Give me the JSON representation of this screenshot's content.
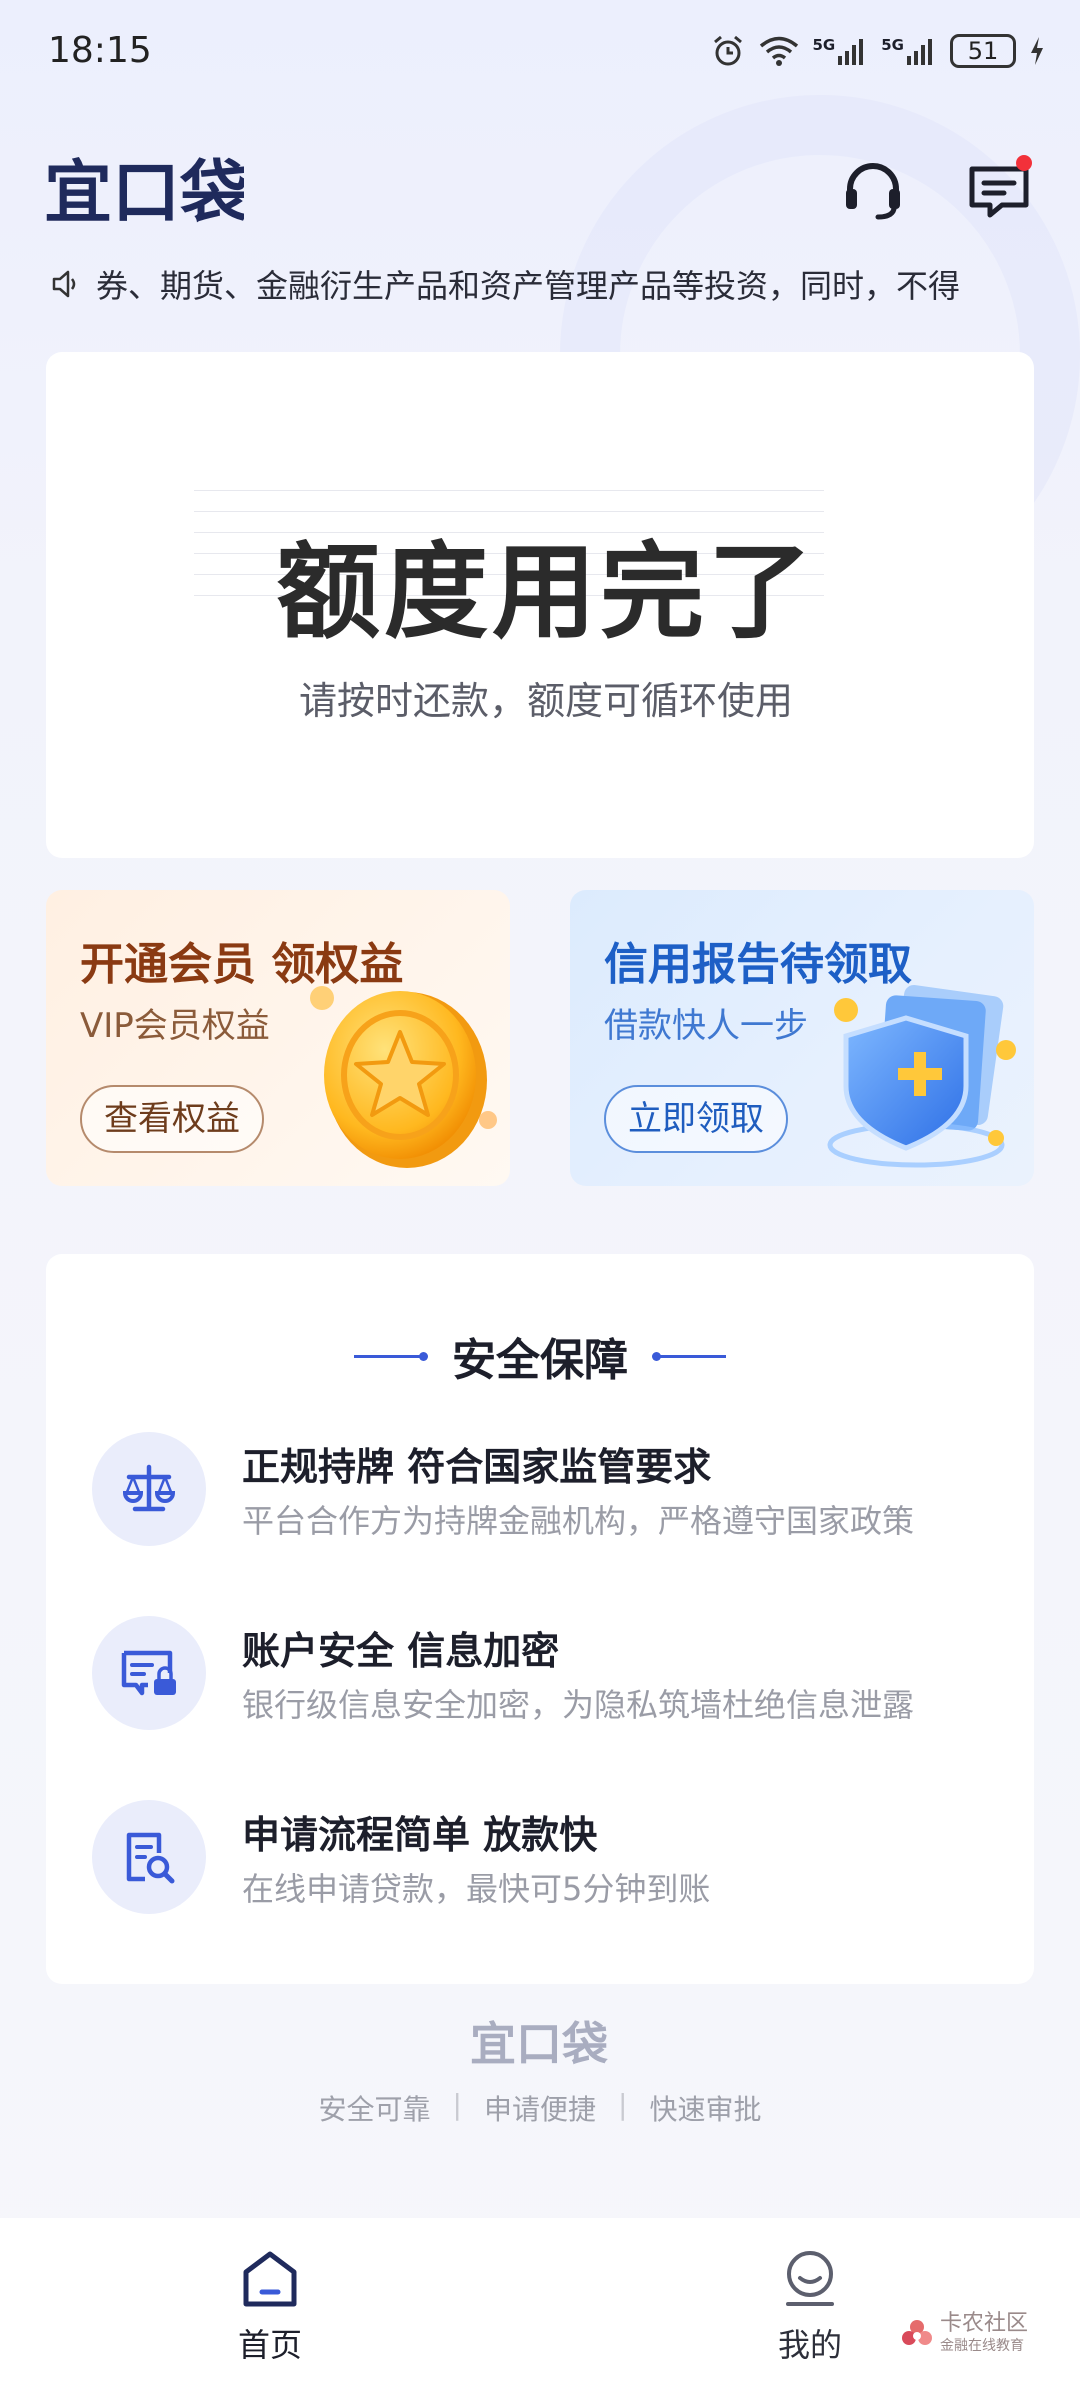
{
  "status_bar": {
    "time": "18:15",
    "battery": "51",
    "signal_1_label": "5G",
    "signal_2_label": "5G"
  },
  "header": {
    "brand_name": "宜口袋",
    "customer_service_icon": "headset-icon",
    "message_icon": "message-icon",
    "has_unread_messages": true
  },
  "notice": {
    "icon": "speaker-icon",
    "text": "券、期货、金融衍生产品和资产管理产品等投资，同时，不得"
  },
  "quota_card": {
    "title": "额度用完了",
    "subtitle": "请按时还款，额度可循环使用"
  },
  "promos": [
    {
      "title": "开通会员 领权益",
      "subtitle": "VIP会员权益",
      "button": "查看权益",
      "art": "gold-star-coin"
    },
    {
      "title": "信用报告待领取",
      "subtitle": "借款快人一步",
      "button": "立即领取",
      "art": "blue-shield"
    }
  ],
  "security": {
    "title": "安全保障",
    "items": [
      {
        "icon": "scale-icon",
        "title": "正规持牌 符合国家监管要求",
        "desc": "平台合作方为持牌金融机构，严格遵守国家政策"
      },
      {
        "icon": "secure-card-icon",
        "title": "账户安全 信息加密",
        "desc": "银行级信息安全加密，为隐私筑墙杜绝信息泄露"
      },
      {
        "icon": "document-search-icon",
        "title": "申请流程简单 放款快",
        "desc": "在线申请贷款，最快可5分钟到账"
      }
    ]
  },
  "footer": {
    "brand_name": "宜口袋",
    "tags": [
      "安全可靠",
      "申请便捷",
      "快速审批"
    ],
    "separator": "|"
  },
  "bottom_nav": {
    "items": [
      {
        "label": "首页",
        "icon": "home-icon",
        "active": true
      },
      {
        "label": "我的",
        "icon": "profile-icon",
        "active": false
      }
    ]
  },
  "watermark": {
    "line1": "卡农社区",
    "line2": "金融在线教育"
  },
  "colors": {
    "brand_navy": "#1f2a5c",
    "accent_blue": "#3a5ad8",
    "alert_red": "#f2313a"
  }
}
